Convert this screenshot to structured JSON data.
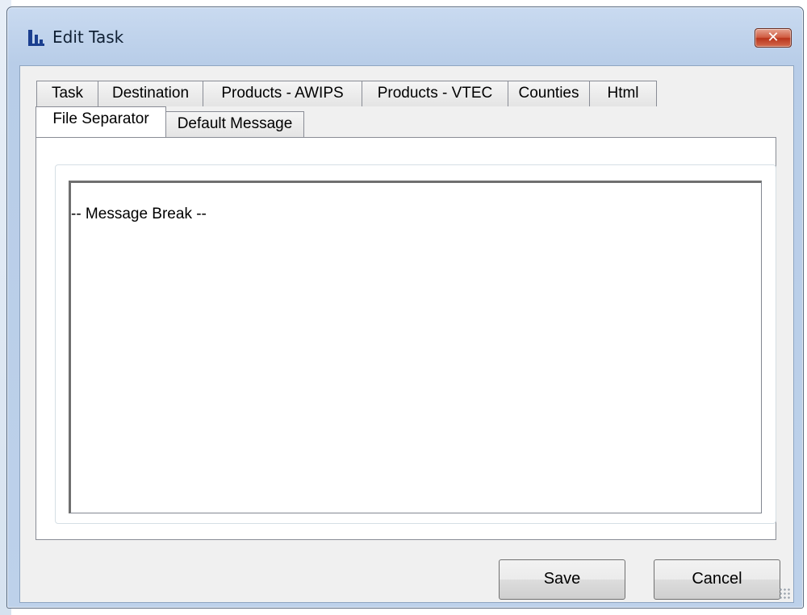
{
  "window": {
    "title": "Edit Task",
    "close_label": "✕",
    "app_icon": "chart-logo-icon"
  },
  "tabs": {
    "row1": [
      "Task",
      "Destination",
      "Products - AWIPS",
      "Products - VTEC",
      "Counties",
      "Html"
    ],
    "row2": [
      "File Separator",
      "Default Message"
    ],
    "active": "File Separator"
  },
  "panel": {
    "textbox_value": "-- Message Break --"
  },
  "buttons": {
    "save_label": "Save",
    "cancel_label": "Cancel"
  },
  "colors": {
    "title_bar": "#bdd1ea",
    "close_button": "#c94a30",
    "client_bg": "#f0f0f0"
  }
}
